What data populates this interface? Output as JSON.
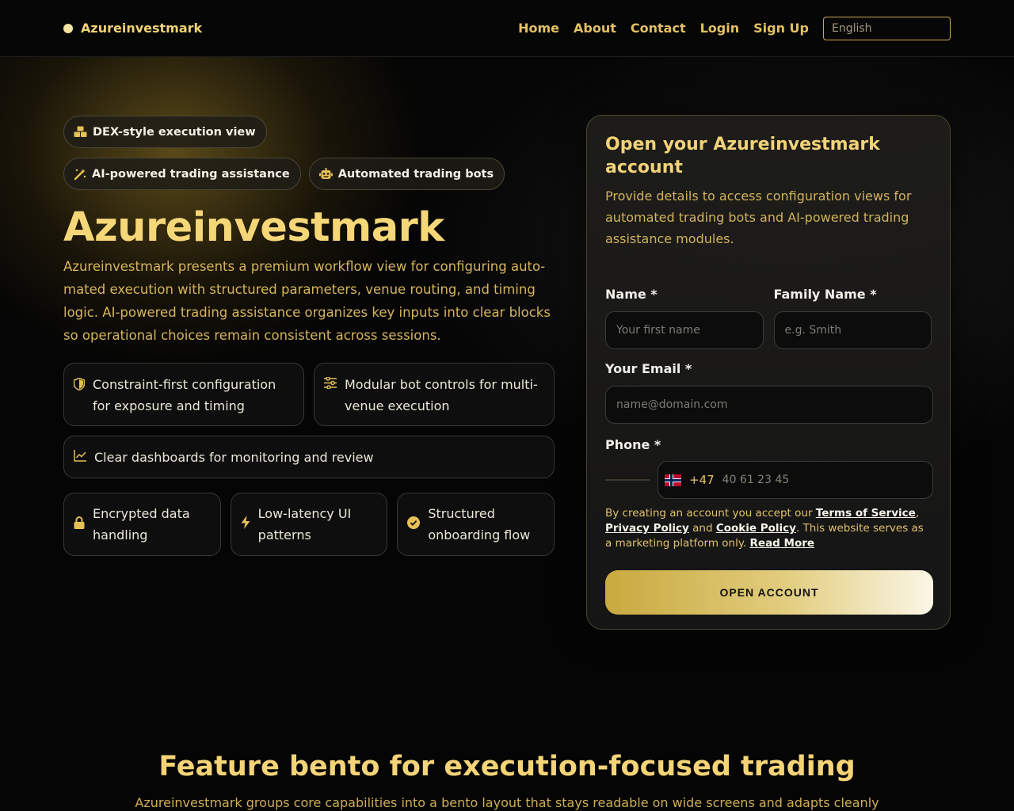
{
  "header": {
    "brand": "Azureinvestmark",
    "nav": [
      "Home",
      "About",
      "Contact",
      "Login",
      "Sign Up"
    ],
    "language": "English"
  },
  "hero": {
    "pills": [
      "DEX-style execution view",
      "AI-powered trading assistance",
      "Automated trading bots"
    ],
    "title": "Azureinvestmark",
    "description": "Azureinvestmark presents a premium workflow view for configuring auto­mated execution with structured parameters, venue routing, and timing logic. AI-powered trading assistance organizes key inputs into clear blocks so op­erational choices remain consistent across sessions.",
    "features": [
      "Constraint-first configuration for exposure and timing",
      "Modular bot controls for multi-venue execution",
      "Clear dashboards for monitoring and review",
      "Encrypted data handling",
      "Low-latency UI patterns",
      "Structured onboarding flow"
    ]
  },
  "form": {
    "title": "Open your Azureinvestmark account",
    "subtitle": "Provide details to access configuration views for auto­mated trading bots and AI-powered trading assistance modules.",
    "name_label": "Name *",
    "name_placeholder": "Your first name",
    "family_label": "Family Name *",
    "family_placeholder": "e.g. Smith",
    "email_label": "Your Email *",
    "email_placeholder": "name@domain.com",
    "phone_label": "Phone *",
    "dial_code": "+47",
    "phone_placeholder": "40 61 23 45",
    "terms_prefix": "By creating an account you accept our ",
    "terms_link": "Terms of Service",
    "terms_comma": ",",
    "privacy_link": "Privacy Policy",
    "terms_and": " and ",
    "cookie_link": "Cookie Policy",
    "terms_suffix": ". This website serves as a marketing platform only. ",
    "read_more": "Read More",
    "submit": "OPEN ACCOUNT"
  },
  "section": {
    "title": "Feature bento for execution-focused trading",
    "description": "Azureinvestmark groups core capabilities into a bento layout that stays readable on wide screens and adapts cleanly"
  },
  "colors": {
    "accent": "#f2d378",
    "background": "#050505"
  }
}
